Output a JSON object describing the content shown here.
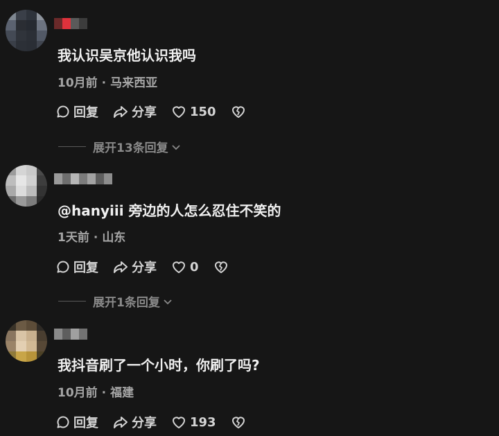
{
  "comments": [
    {
      "text": "我认识吴京他认识我吗",
      "time": "10月前",
      "separator": "·",
      "location": "马来西亚",
      "reply_label": "回复",
      "share_label": "分享",
      "like_count": "150",
      "expand_label": "展开13条回复"
    },
    {
      "text": "@hanyiii 旁边的人怎么忍住不笑的",
      "time": "1天前",
      "separator": "·",
      "location": "山东",
      "reply_label": "回复",
      "share_label": "分享",
      "like_count": "0",
      "expand_label": "展开1条回复"
    },
    {
      "text": "我抖音刷了一个小时，你刷了吗?",
      "time": "10月前",
      "separator": "·",
      "location": "福建",
      "reply_label": "回复",
      "share_label": "分享",
      "like_count": "193"
    }
  ],
  "colors": {
    "background": "#161616",
    "text": "#f0f0f0",
    "meta": "#a6a6a6",
    "muted": "#8a8a8a"
  }
}
